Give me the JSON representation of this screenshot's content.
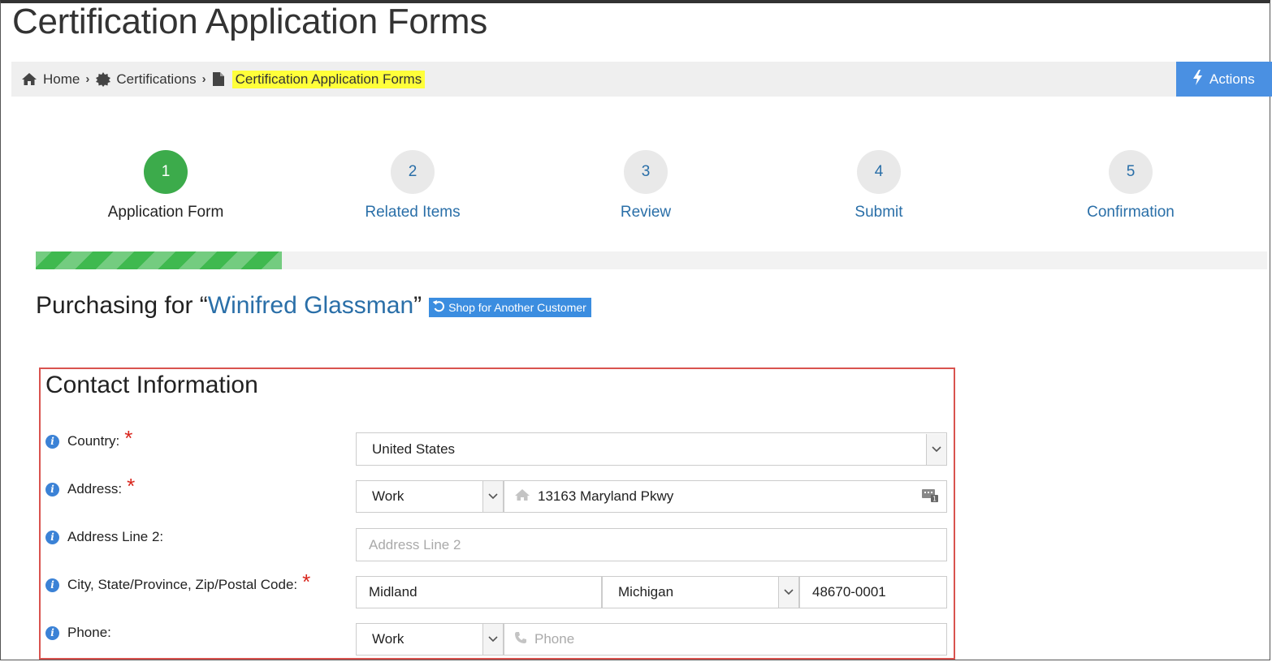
{
  "page_title": "Certification Application Forms",
  "breadcrumb": {
    "items": [
      "Home",
      "Certifications",
      "Certification Application Forms"
    ],
    "icons": [
      "home-icon",
      "badge-icon",
      "file-icon"
    ],
    "highlight_color": "#ffff3a"
  },
  "actions": {
    "label": "Actions",
    "icon": "bolt-icon",
    "color": "#4a90e2"
  },
  "steps": [
    {
      "number": "1",
      "label": "Application Form",
      "active": true
    },
    {
      "number": "2",
      "label": "Related Items",
      "active": false
    },
    {
      "number": "3",
      "label": "Review",
      "active": false
    },
    {
      "number": "4",
      "label": "Submit",
      "active": false
    },
    {
      "number": "5",
      "label": "Confirmation",
      "active": false
    }
  ],
  "progress": {
    "fraction": 0.2,
    "color": "#3fb94f"
  },
  "purchasing": {
    "prefix": "Purchasing for “",
    "customer": "Winifred Glassman",
    "suffix": "”",
    "shop_button": "Shop for Another Customer"
  },
  "contact": {
    "title": "Contact Information",
    "country": {
      "label": "Country:",
      "value": "United States",
      "required": true
    },
    "address": {
      "label": "Address:",
      "type": "Work",
      "value": "13163 Maryland Pkwy",
      "required": true
    },
    "address2": {
      "label": "Address Line 2:",
      "placeholder": "Address Line 2"
    },
    "city_state_zip": {
      "label": "City, State/Province, Zip/Postal Code:",
      "city": "Midland",
      "state": "Michigan",
      "zip": "48670-0001",
      "required": true
    },
    "phone": {
      "label": "Phone:",
      "type": "Work",
      "placeholder": "Phone"
    }
  },
  "colors": {
    "accent": "#2a6fa8",
    "required": "#d9251c",
    "active_step": "#3cab4b",
    "border_highlight": "#d9534f"
  }
}
